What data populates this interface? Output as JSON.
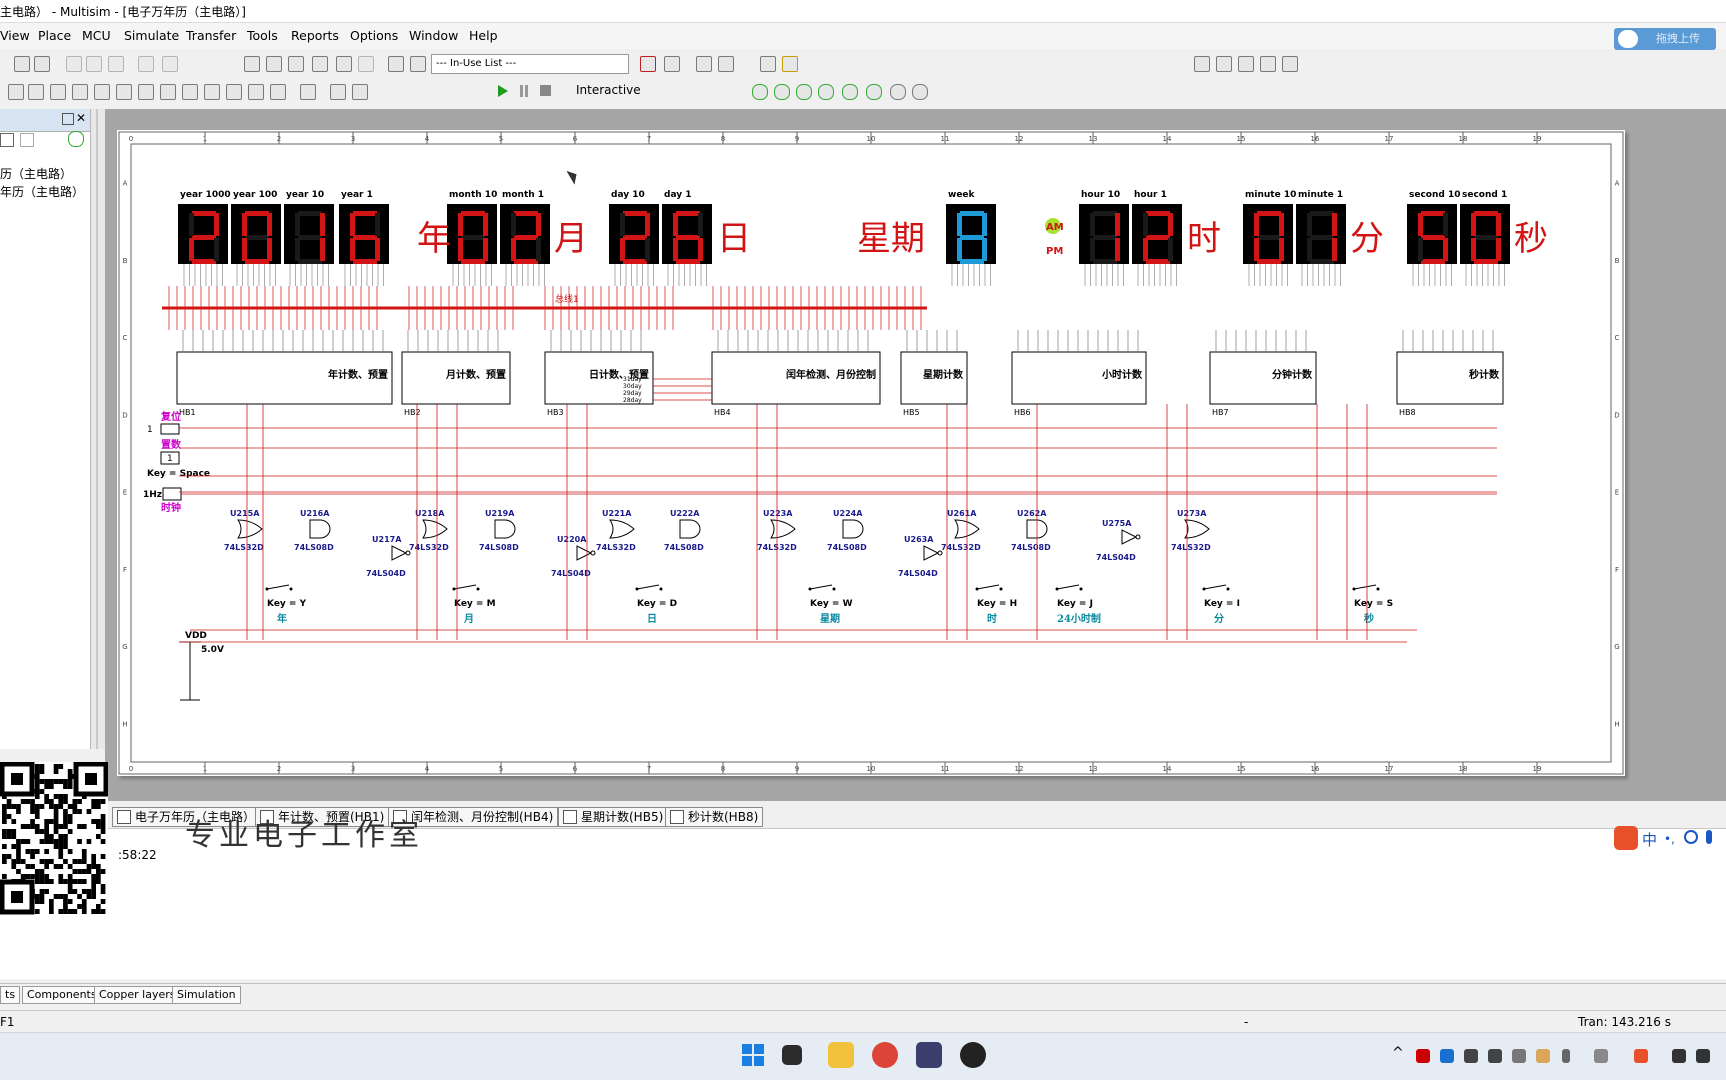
{
  "window": {
    "title": "主电路） - Multisim - [电子万年历（主电路）]"
  },
  "menu": [
    "View",
    "Place",
    "MCU",
    "Simulate",
    "Transfer",
    "Tools",
    "Reports",
    "Options",
    "Window",
    "Help"
  ],
  "upload_button": "拖拽上传",
  "toolbar": {
    "in_use_list": "--- In-Use List ---",
    "interactive": "Interactive"
  },
  "left_panel": {
    "item1": "历（主电路）",
    "item2": "年历（主电路）"
  },
  "schematic": {
    "col_labels": [
      "0",
      "1",
      "2",
      "3",
      "4",
      "5",
      "6",
      "7",
      "8",
      "9",
      "10",
      "11",
      "12",
      "13",
      "14",
      "15",
      "16",
      "17",
      "18",
      "19"
    ],
    "row_labels": [
      "A",
      "B",
      "C",
      "D",
      "E",
      "F",
      "G",
      "H"
    ],
    "digit_labels": [
      "year 1000",
      "year 100",
      "year 10",
      "year 1",
      "month 10",
      "month 1",
      "day 10",
      "day 1",
      "week",
      "hour 10",
      "hour 1",
      "minute 10",
      "minute 1",
      "second 10",
      "second 1"
    ],
    "digits": [
      "2",
      "0",
      "1",
      "6",
      "0",
      "2",
      "2",
      "6",
      "8",
      "1",
      "2",
      "0",
      "1",
      "5",
      "0"
    ],
    "units": {
      "year": "年",
      "month": "月",
      "day": "日",
      "week": "星期",
      "hour": "时",
      "minute": "分",
      "second": "秒"
    },
    "am": "AM",
    "pm": "PM",
    "bus_label": "总线1",
    "blocks": [
      {
        "id": "HB1",
        "label": "年计数、预置"
      },
      {
        "id": "HB2",
        "label": "月计数、预置"
      },
      {
        "id": "HB3",
        "label": "日计数、预置"
      },
      {
        "id": "HB4",
        "label": "闰年检测、月份控制"
      },
      {
        "id": "HB5",
        "label": "星期计数"
      },
      {
        "id": "HB6",
        "label": "小时计数"
      },
      {
        "id": "HB7",
        "label": "分钟计数"
      },
      {
        "id": "HB8",
        "label": "秒计数"
      }
    ],
    "day_outputs": [
      "31day",
      "30day",
      "29day",
      "28day"
    ],
    "left_labels": {
      "reset": "复位",
      "preset": "置数",
      "key": "Key = Space",
      "one": "1",
      "freq": "1Hz",
      "clock": "时钟",
      "vdd": "VDD",
      "vdd_val": "5.0V"
    },
    "gates": [
      {
        "ref": "U215A",
        "type": "74LS32D"
      },
      {
        "ref": "U216A",
        "type": "74LS08D"
      },
      {
        "ref": "U217A",
        "type": "74LS04D"
      },
      {
        "ref": "U218A",
        "type": "74LS32D"
      },
      {
        "ref": "U219A",
        "type": "74LS08D"
      },
      {
        "ref": "U220A",
        "type": "74LS04D"
      },
      {
        "ref": "U221A",
        "type": "74LS32D"
      },
      {
        "ref": "U222A",
        "type": "74LS08D"
      },
      {
        "ref": "U223A",
        "type": "74LS32D"
      },
      {
        "ref": "U224A",
        "type": "74LS08D"
      },
      {
        "ref": "U263A",
        "type": "74LS04D"
      },
      {
        "ref": "U261A",
        "type": "74LS32D"
      },
      {
        "ref": "U262A",
        "type": "74LS08D"
      },
      {
        "ref": "U275A",
        "type": "74LS04D"
      },
      {
        "ref": "U273A",
        "type": "74LS32D"
      }
    ],
    "keys": [
      {
        "key": "Key = Y",
        "label": "年"
      },
      {
        "key": "Key = M",
        "label": "月"
      },
      {
        "key": "Key = D",
        "label": "日"
      },
      {
        "key": "Key = W",
        "label": "星期"
      },
      {
        "key": "Key = H",
        "label": "时"
      },
      {
        "key": "Key = J",
        "label": "24小时制"
      },
      {
        "key": "Key = I",
        "label": "分"
      },
      {
        "key": "Key = S",
        "label": "秒"
      }
    ]
  },
  "doc_tabs": [
    "电子万年历（主电路）",
    "年计数、预置(HB1)",
    "闰年检测、月份控制(HB4)",
    "星期计数(HB5)",
    "秒计数(HB8)"
  ],
  "watermark": "专业电子工作室",
  "timestamp": ":58:22",
  "ime_text": "中",
  "panel_tabs": [
    "ts",
    "Components",
    "Copper layers",
    "Simulation"
  ],
  "status": {
    "left": "F1",
    "middle": "-",
    "right": "Tran: 143.216 s"
  }
}
